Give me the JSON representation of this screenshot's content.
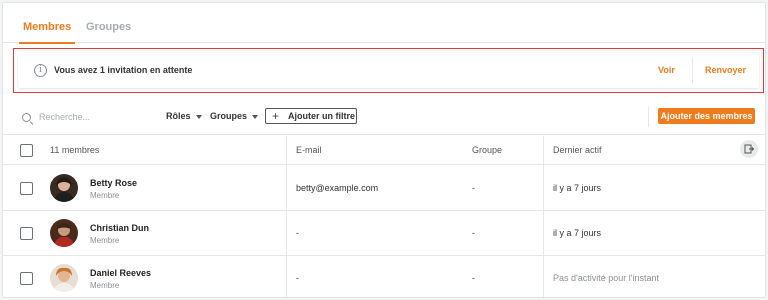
{
  "tabs": [
    {
      "label": "Membres",
      "active": true
    },
    {
      "label": "Groupes",
      "active": false
    }
  ],
  "banner": {
    "text": "Vous avez 1 invitation en attente",
    "view_label": "Voir",
    "resend_label": "Renvoyer",
    "icon": "info-icon"
  },
  "toolbar": {
    "search_placeholder": "Recherche...",
    "roles_label": "Rôles",
    "groups_label": "Groupes",
    "add_filter_label": "Ajouter un filtre",
    "add_members_label": "Ajouter des membres"
  },
  "table": {
    "headers": {
      "members": "11 membres",
      "email": "E-mail",
      "group": "Groupe",
      "last_active": "Dernier actif"
    },
    "rows": [
      {
        "name": "Betty Rose",
        "role": "Membre",
        "email": "betty@example.com",
        "group": "-",
        "last_active": "il y a 7 jours"
      },
      {
        "name": "Christian Dun",
        "role": "Membre",
        "email": "-",
        "group": "-",
        "last_active": "il y a 7 jours"
      },
      {
        "name": "Daniel Reeves",
        "role": "Membre",
        "email": "-",
        "group": "-",
        "last_active": "Pas d'activité pour l'instant"
      }
    ]
  },
  "colors": {
    "accent": "#f07b1d",
    "highlight_border": "#e03a3a"
  }
}
